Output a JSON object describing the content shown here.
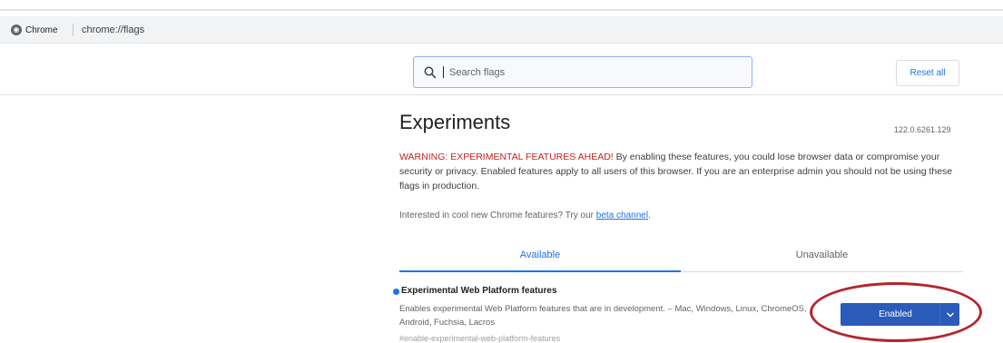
{
  "browser": {
    "chip_label": "Chrome",
    "url": "chrome://flags"
  },
  "search": {
    "placeholder": "Search flags"
  },
  "header": {
    "reset_label": "Reset all"
  },
  "page": {
    "title": "Experiments",
    "version": "122.0.6261.129",
    "warning_strong": "WARNING: EXPERIMENTAL FEATURES AHEAD!",
    "warning_body": " By enabling these features, you could lose browser data or compromise your security or privacy. Enabled features apply to all users of this browser. If you are an enterprise admin you should not be using these flags in production.",
    "interest_text": "Interested in cool new Chrome features? Try our ",
    "beta_link": "beta channel",
    "interest_end": "."
  },
  "tabs": [
    {
      "label": "Available",
      "selected": true
    },
    {
      "label": "Unavailable",
      "selected": false
    }
  ],
  "flag": {
    "title": "Experimental Web Platform features",
    "description": "Enables experimental Web Platform features that are in development. – Mac, Windows, Linux, ChromeOS, Android, Fuchsia, Lacros",
    "anchor": "#enable-experimental-web-platform-features",
    "selected_value": "Enabled"
  },
  "colors": {
    "accent": "#1a73e8",
    "select_bg": "#2b5bb8",
    "warning": "#c5221f",
    "annotation": "#b3262b"
  },
  "icons": {
    "chip": "chrome-icon",
    "search": "search-icon",
    "dropdown": "chevron-down-icon"
  }
}
